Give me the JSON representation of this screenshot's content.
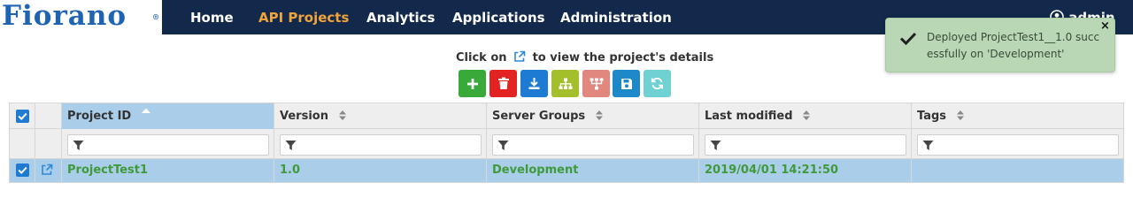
{
  "nav": {
    "logo_text": "Fiorano",
    "items": [
      {
        "label": "Home",
        "active": false
      },
      {
        "label": "API Projects",
        "active": true
      },
      {
        "label": "Analytics",
        "active": false
      },
      {
        "label": "Applications",
        "active": false
      },
      {
        "label": "Administration",
        "active": false
      }
    ],
    "user_label": "admin"
  },
  "toast": {
    "message": "Deployed ProjectTest1__1.0 successfully on 'Development'",
    "close_label": "×"
  },
  "hint": {
    "prefix": "Click on",
    "suffix": "to view the project's details"
  },
  "toolbar": {
    "buttons": [
      {
        "name": "add",
        "icon": "plus-icon",
        "color": "#39a939"
      },
      {
        "name": "delete",
        "icon": "trash-icon",
        "color": "#e32222"
      },
      {
        "name": "import",
        "icon": "download-icon",
        "color": "#1e7bd4"
      },
      {
        "name": "hierarchy",
        "icon": "sitemap-icon",
        "color": "#a4bf2c"
      },
      {
        "name": "flow",
        "icon": "flow-icon",
        "color": "#e1877d"
      },
      {
        "name": "save",
        "icon": "save-icon",
        "color": "#1d89c9"
      },
      {
        "name": "refresh",
        "icon": "refresh-icon",
        "color": "#6fd1d1"
      }
    ]
  },
  "table": {
    "columns": [
      {
        "label": "Project ID",
        "sorted": "asc"
      },
      {
        "label": "Version"
      },
      {
        "label": "Server Groups"
      },
      {
        "label": "Last modified"
      },
      {
        "label": "Tags"
      }
    ],
    "rows": [
      {
        "selected": true,
        "project_id": "ProjectTest1",
        "version": "1.0",
        "server_groups": "Development",
        "last_modified": "2019/04/01 14:21:50",
        "tags": ""
      }
    ]
  },
  "colors": {
    "nav_bg": "#13294b",
    "nav_active": "#f0a43a",
    "row_selected": "#aacdea",
    "row_text": "#3f9a3a",
    "toast_bg": "#b9d7b4"
  }
}
